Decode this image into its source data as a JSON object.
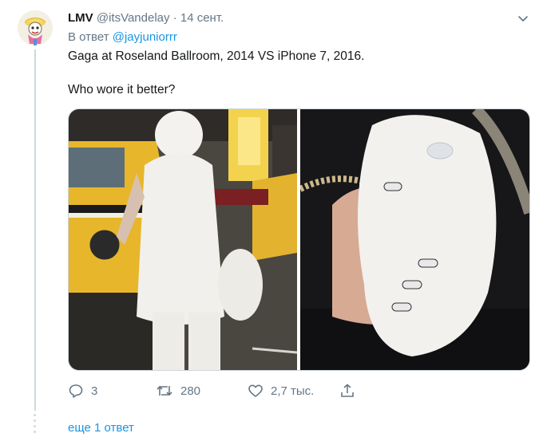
{
  "tweet": {
    "display_name": "LMV",
    "handle": "@itsVandelay",
    "separator": "·",
    "date": "14 сент.",
    "reply_prefix": "В ответ",
    "reply_to": "@jayjuniorrr",
    "text_line1": "Gaga at Roseland Ballroom, 2014 VS iPhone 7, 2016.",
    "text_line2": "Who wore it better?"
  },
  "actions": {
    "reply_count": "3",
    "retweet_count": "280",
    "like_count": "2,7 тыс."
  },
  "thread": {
    "more_replies_label": "еще 1 ответ"
  },
  "colors": {
    "link": "#1b95e0",
    "muted": "#657786",
    "thread_line": "#cfd9de"
  },
  "icons": [
    "avatar",
    "chevron-down-icon",
    "reply-icon",
    "retweet-icon",
    "like-icon",
    "share-icon"
  ]
}
